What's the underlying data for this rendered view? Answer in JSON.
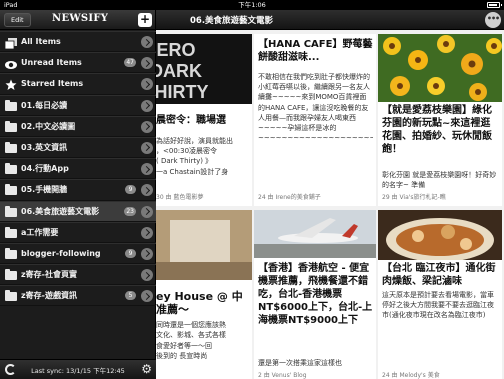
{
  "statusbar": {
    "carrier": "iPad",
    "time": "下午1:06",
    "battery_level": 0.7
  },
  "sidebar": {
    "edit_label": "Edit",
    "logo": "NEWSIFY",
    "add_label": "+",
    "items": [
      {
        "label": "All Items",
        "icon": "all-items-icon",
        "count": ""
      },
      {
        "label": "Unread Items",
        "icon": "eye-icon",
        "count": "47"
      },
      {
        "label": "Starred Items",
        "icon": "star-icon",
        "count": ""
      },
      {
        "label": "01.每日必讀",
        "icon": "folder-icon",
        "count": ""
      },
      {
        "label": "02.中文必讀圖",
        "icon": "folder-icon",
        "count": ""
      },
      {
        "label": "03.英文資訊",
        "icon": "folder-icon",
        "count": ""
      },
      {
        "label": "04.行動App",
        "icon": "folder-icon",
        "count": ""
      },
      {
        "label": "05.手機開牆",
        "icon": "folder-icon",
        "count": "9"
      },
      {
        "label": "06.美食旅遊藝文電影",
        "icon": "folder-icon",
        "count": "23"
      },
      {
        "label": "a工作需要",
        "icon": "folder-icon",
        "count": ""
      },
      {
        "label": "blogger-following",
        "icon": "folder-icon",
        "count": "9"
      },
      {
        "label": "z寄存-社會頁實",
        "icon": "folder-icon",
        "count": ""
      },
      {
        "label": "z寄存-遊戲資訊",
        "icon": "folder-icon",
        "count": "5"
      }
    ],
    "selected_index": 8,
    "sync_text": "Last sync: 13/1/15 下午12:45"
  },
  "main": {
    "title": "06.美食旅遊藝文電影",
    "more_label": "•••",
    "cards": {
      "c1": {
        "title": "晨密令：職場選",
        "body": "為話好好說，演員就能出\n，<00:30凌晨密令\n( Dark Thirty) 》\n一a Chastain設計了身",
        "meta": "30 由 藍色電影夢"
      },
      "c2": {
        "title": "【HANA CAFE】野莓藝餅酸甜滋味...",
        "body": "不敢相信在我們吃到肚子都快爆炸的小紅莓吞嚥以後，繼續跟另一名友人續攤~~~~~來到MOMO百貨裡面的HANA CAFE，讓這沒吃晚餐的友人用餐—而我跟孕婦友人喝東西~~~~~孕婦這杯是冰的~~~~~~~~~~~~~~~~~~~~~~~~~~~~~~~~~~~~~~~~~~~~~~~~~~~~~~~~~~~~~~~~~~~~~",
        "meta": "24 由 Irene的美食鋪子"
      },
      "c3": {
        "title": "【就是愛荔枝樂園】綠化芬園的新玩點~來這裡逛花園、拍婚紗、玩休閒飯飽！",
        "body": "彰化芬園 就是愛荔枝樂園呀！好奇妙的名字~ 準備",
        "meta": "29 由 Via's旅行札記-瞧"
      },
      "c4": {
        "title": "ey House @ 中\n准薦～",
        "body": "\n同時還是一個您應該熱\n文化、影城、各式各樣\n食愛好者等一～回\n後到的 長宣時尚",
        "meta": ""
      },
      "c5": {
        "title": "【香港】香港航空 - 便宜機票推薦，飛機餐還不錯吃，台北-香港機票NT$6000上下，台北-上海機票NT$9000上下",
        "body": "還是第一次搭乘這家這樣也",
        "meta": "2 由 Venus' Blog"
      },
      "c6": {
        "title": "【台北 臨江夜市】通化街肉燥飯、梁記滷味",
        "body": "這天原本是預計要去看場電影，當車停好之後大方間我要不要去逛臨江夜市(通化夜市現在改名為臨江夜市)",
        "meta": "24 由 Melody's 美食"
      }
    }
  },
  "colors": {
    "sidebar_bg": "#1c1c1c",
    "accent": "#ffffff",
    "badge": "#8a8a8a"
  }
}
